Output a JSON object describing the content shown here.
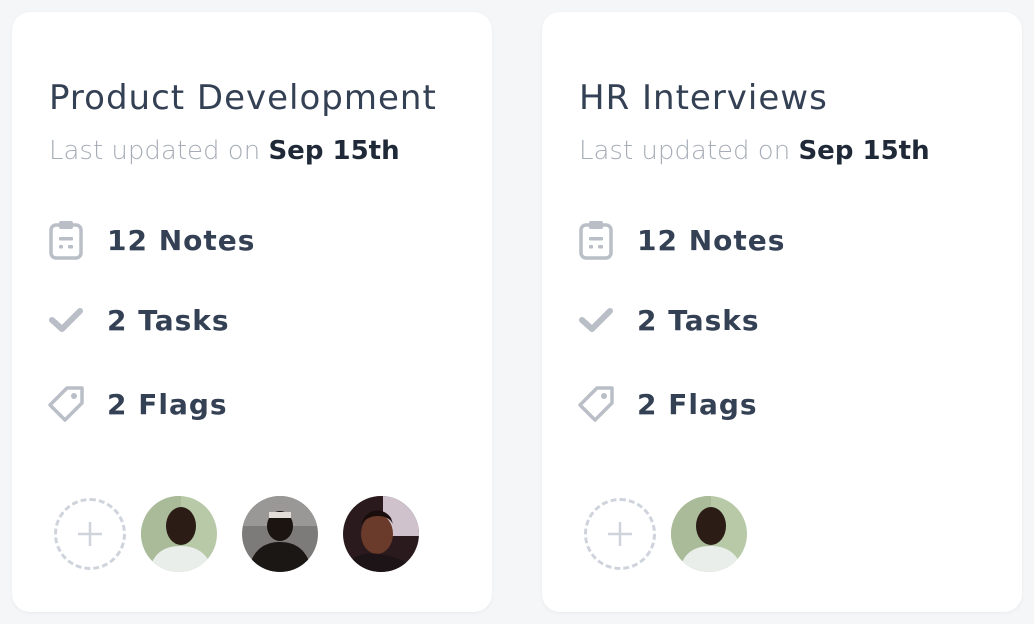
{
  "projects": [
    {
      "title": "Product Development",
      "updated_prefix": "Last updated on",
      "updated_date": "Sep 15th",
      "stats": {
        "notes": "12 Notes",
        "tasks": "2 Tasks",
        "flags": "2 Flags"
      },
      "members": [
        "avatar-1",
        "avatar-2",
        "avatar-3"
      ]
    },
    {
      "title": "HR Interviews",
      "updated_prefix": "Last updated on",
      "updated_date": "Sep 15th",
      "stats": {
        "notes": "12 Notes",
        "tasks": "2 Tasks",
        "flags": "2 Flags"
      },
      "members": [
        "avatar-1"
      ]
    }
  ],
  "icons": {
    "notes": "clipboard-icon",
    "tasks": "checkmark-icon",
    "flags": "tag-icon",
    "add_member": "plus-icon"
  },
  "colors": {
    "icon_gray": "#b9bec7",
    "title": "#344054",
    "muted": "#a7adb7"
  }
}
